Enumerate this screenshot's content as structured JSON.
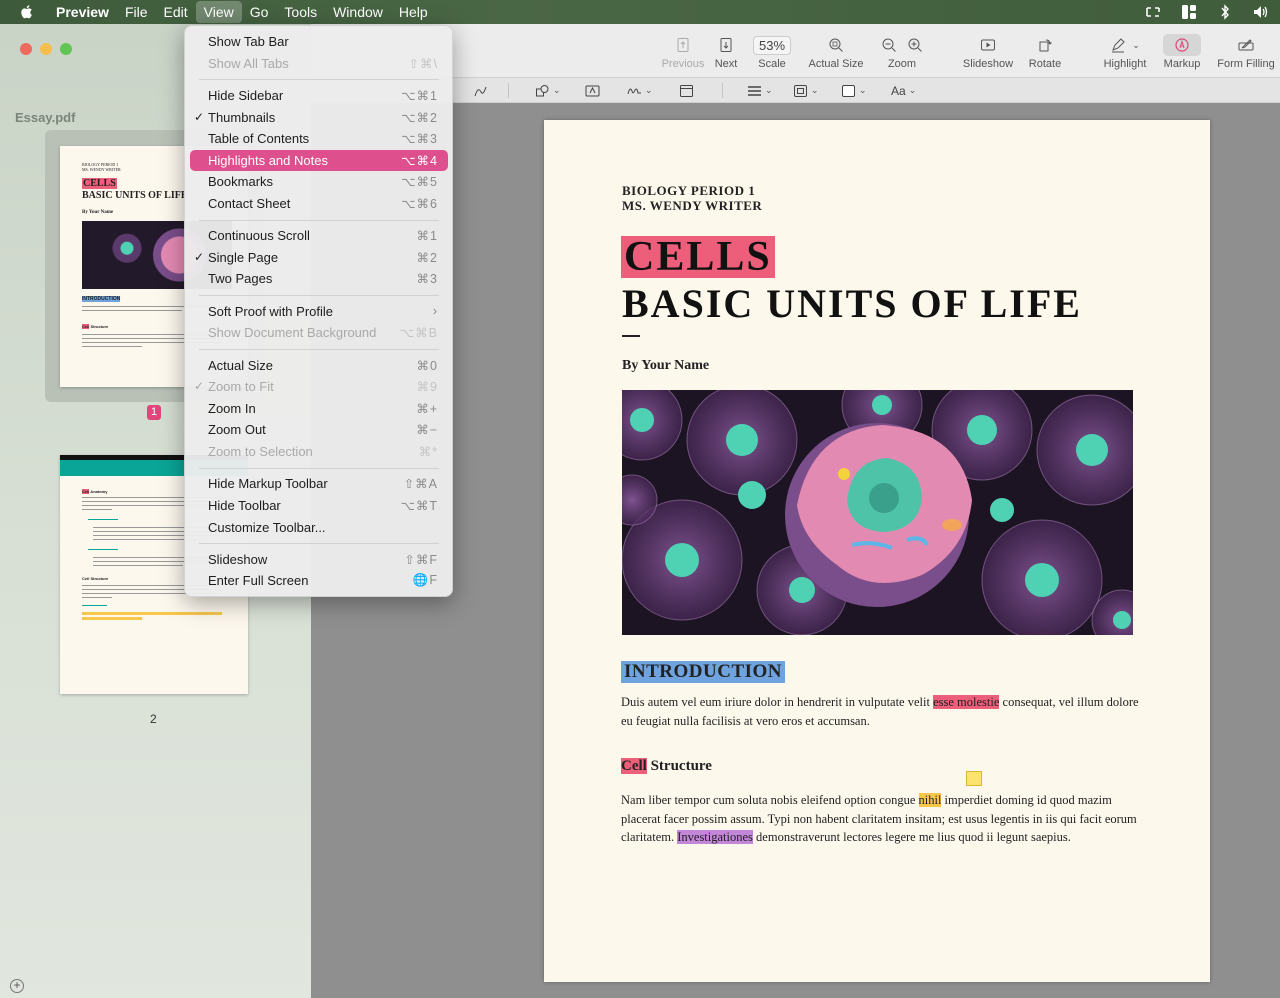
{
  "menubar": {
    "items": [
      {
        "label": "Preview",
        "bold": true
      },
      {
        "label": "File"
      },
      {
        "label": "Edit"
      },
      {
        "label": "View",
        "active": true
      },
      {
        "label": "Go"
      },
      {
        "label": "Tools"
      },
      {
        "label": "Window"
      },
      {
        "label": "Help"
      }
    ]
  },
  "sidebar": {
    "title": "Essay.pdf",
    "pages": [
      {
        "number": "1",
        "selected": true
      },
      {
        "number": "2",
        "selected": false
      }
    ]
  },
  "toolbar": {
    "previous": "Previous",
    "next": "Next",
    "scale_value": "53%",
    "scale": "Scale",
    "actual_size": "Actual Size",
    "zoom": "Zoom",
    "slideshow": "Slideshow",
    "rotate": "Rotate",
    "highlight": "Highlight",
    "markup": "Markup",
    "form_filling": "Form Filling"
  },
  "markup_toolbar": {
    "font_label": "Aa"
  },
  "view_menu": {
    "items": [
      {
        "label": "Show Tab Bar",
        "shortcut": "",
        "enabled": true
      },
      {
        "label": "Show All Tabs",
        "shortcut": "⇧⌘\\",
        "enabled": false
      },
      {
        "separator": true
      },
      {
        "label": "Hide Sidebar",
        "shortcut": "⌥⌘1",
        "enabled": true
      },
      {
        "label": "Thumbnails",
        "shortcut": "⌥⌘2",
        "enabled": true,
        "checked": true
      },
      {
        "label": "Table of Contents",
        "shortcut": "⌥⌘3",
        "enabled": true
      },
      {
        "label": "Highlights and Notes",
        "shortcut": "⌥⌘4",
        "enabled": true,
        "highlighted": true
      },
      {
        "label": "Bookmarks",
        "shortcut": "⌥⌘5",
        "enabled": true
      },
      {
        "label": "Contact Sheet",
        "shortcut": "⌥⌘6",
        "enabled": true
      },
      {
        "separator": true
      },
      {
        "label": "Continuous Scroll",
        "shortcut": "⌘1",
        "enabled": true
      },
      {
        "label": "Single Page",
        "shortcut": "⌘2",
        "enabled": true,
        "checked": true
      },
      {
        "label": "Two Pages",
        "shortcut": "⌘3",
        "enabled": true
      },
      {
        "separator": true
      },
      {
        "label": "Soft Proof with Profile",
        "shortcut": "›",
        "enabled": true
      },
      {
        "label": "Show Document Background",
        "shortcut": "⌥⌘B",
        "enabled": false
      },
      {
        "separator": true
      },
      {
        "label": "Actual Size",
        "shortcut": "⌘0",
        "enabled": true
      },
      {
        "label": "Zoom to Fit",
        "shortcut": "⌘9",
        "enabled": false,
        "checked": true
      },
      {
        "label": "Zoom In",
        "shortcut": "⌘+",
        "enabled": true
      },
      {
        "label": "Zoom Out",
        "shortcut": "⌘−",
        "enabled": true
      },
      {
        "label": "Zoom to Selection",
        "shortcut": "⌘*",
        "enabled": false
      },
      {
        "separator": true
      },
      {
        "label": "Hide Markup Toolbar",
        "shortcut": "⇧⌘A",
        "enabled": true
      },
      {
        "label": "Hide Toolbar",
        "shortcut": "⌥⌘T",
        "enabled": true
      },
      {
        "label": "Customize Toolbar...",
        "shortcut": "",
        "enabled": true
      },
      {
        "separator": true
      },
      {
        "label": "Slideshow",
        "shortcut": "⇧⌘F",
        "enabled": true
      },
      {
        "label": "Enter Full Screen",
        "shortcut": "🌐F",
        "enabled": true
      }
    ]
  },
  "document": {
    "header_line1": "BIOLOGY PERIOD 1",
    "header_line2": "MS. WENDY WRITER",
    "title_highlight": "CELLS",
    "title_main": "BASIC UNITS OF LIFE",
    "byline": "By Your Name",
    "intro_heading": "INTRODUCTION",
    "intro_p_before": "Duis autem vel eum iriure dolor in hendrerit in vulputate velit ",
    "intro_p_highlight": "esse molestie",
    "intro_p_after": " consequat, vel illum dolore eu feugiat nulla facilisis at vero eros et accumsan.",
    "section_heading_highlight": "Cell",
    "section_heading_rest": " Structure",
    "body_p_part1": "Nam liber tempor cum soluta nobis eleifend option congue ",
    "body_p_hl1": "nihil",
    "body_p_part2": " imperdiet doming id quod mazim placerat facer possim assum. Typi non habent claritatem insitam; est usus legentis in iis qui facit eorum claritatem. ",
    "body_p_hl2": "Investigationes",
    "body_p_part3": " demonstraverunt lectores legere me lius quod ii legunt saepius."
  },
  "colors": {
    "highlight_red": "#ec5e79",
    "highlight_blue": "#6fa3e0",
    "highlight_yellow": "#f8c64a",
    "highlight_purple": "#c486d9",
    "menu_selection": "#de508d"
  }
}
